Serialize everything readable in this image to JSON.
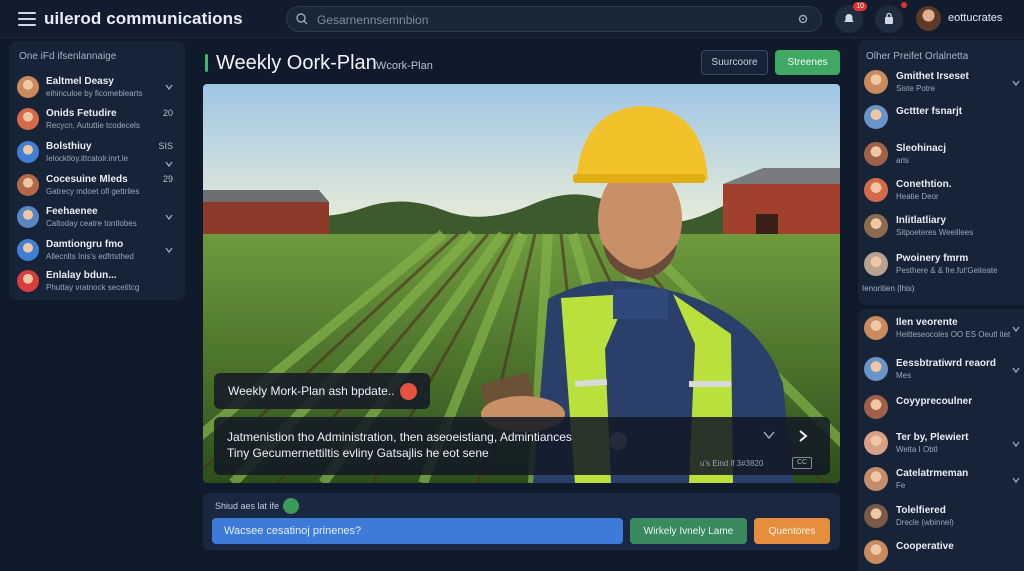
{
  "app": {
    "title": "uilerod communications"
  },
  "search": {
    "placeholder": "Gesarnennsemnbion"
  },
  "topbar": {
    "notification_count": "10",
    "user_name": "eottucrates"
  },
  "left_panel": {
    "title": "One iFd ifsenlannaige",
    "items": [
      {
        "name": "Ealtmel Deasy",
        "sub": "eihinculoe by ficomeblearts",
        "meta": "",
        "avatar_color": "#c98a5e"
      },
      {
        "name": "Onids Fetudire",
        "sub": "Recycn, Aututtie tcodecels",
        "meta": "20",
        "avatar_color": "#d56a4a"
      },
      {
        "name": "Bolsthiuy",
        "sub": "Ielocktloy.ittcatolr.inrt.le",
        "meta": "SIS",
        "avatar_color": "#3f7fd6"
      },
      {
        "name": "Cocesuine Mleds",
        "sub": "Gatrecy mdoet ofl gettriles",
        "meta": "29",
        "avatar_color": "#b2694a"
      },
      {
        "name": "Feehaenee",
        "sub": "Caltoday ceatre tontlobes",
        "meta": "",
        "avatar_color": "#5b86c4"
      },
      {
        "name": "Damtiongru fmo",
        "sub": "Allecnlts Inis's edfrtsthed",
        "meta": "",
        "avatar_color": "#3f7fd6"
      },
      {
        "name": "Enlalay bdun...",
        "sub": "Phuttay vratnock secetitcg",
        "meta": "",
        "avatar_color": "#d93e3e"
      }
    ]
  },
  "main": {
    "title": "Weekly Oork-Plan",
    "subtitle": "Wcork-Plan",
    "btn_source": "Suurcoore",
    "btn_stream": "Streenes",
    "bubble_text": "Weekly Mork-Plan ash bpdate..",
    "caption_line1": "Jatmenistion tho Administration, then aseoeistiang, Admintiances",
    "caption_line2": "Tiny Gecumernettiltis evliny  Gatsajlis he eot sene",
    "caption_timestamp": "u's Eind lf 3#3820",
    "cc_label": "CC"
  },
  "composer": {
    "label": "Shiud aes lat ife",
    "placeholder": "Wacsee cesatinoj prinenes?",
    "btn_weekly": "Wirkely Ivnely Lame",
    "btn_q": "Quentores"
  },
  "right_panel": {
    "title": "Olher Preifet Orlalnetta",
    "section_label": "Ienoritien (lhis)",
    "items_top": [
      {
        "name": "Gmithet Irseset",
        "sub": "Siste Potre",
        "avatar_color": "#c98a5e"
      },
      {
        "name": "Gcttter fsnarjt",
        "sub": "",
        "avatar_color": "#6a95c9"
      },
      {
        "name": "Sleohinacj",
        "sub": "arls",
        "avatar_color": "#a0614a"
      },
      {
        "name": "Conethtion.",
        "sub": "Heatie Deor",
        "avatar_color": "#d56a4a"
      },
      {
        "name": "Inlitlatliary",
        "sub": "Sitpoeteres Weeillees",
        "avatar_color": "#8c6b4f"
      },
      {
        "name": "Pwoinery fmrm",
        "sub": "Pesthere & & fre.fut'Geiteate",
        "avatar_color": "#b7a38f"
      }
    ],
    "items_bottom": [
      {
        "name": "Ilen veorente",
        "sub": "Heitteseocoles\nOO ES Oeutl itet",
        "avatar_color": "#c98a5e"
      },
      {
        "name": "Eessbtratiwrd reaord",
        "sub": "Mes",
        "avatar_color": "#6a95c9"
      },
      {
        "name": "Coyyprecoulner",
        "sub": "",
        "avatar_color": "#a0614a"
      },
      {
        "name": "Ter by, Plewiert",
        "sub": "Welta I Obtl",
        "avatar_color": "#d9a089"
      },
      {
        "name": "Catelatrmeman",
        "sub": "Fe",
        "avatar_color": "#c48c6a"
      },
      {
        "name": "Tolelfiered",
        "sub": "Drecle (wbinnel)",
        "avatar_color": "#7a5a47"
      },
      {
        "name": "Cooperative",
        "sub": "",
        "avatar_color": "#c98a5e"
      }
    ]
  },
  "colors": {
    "accent_green": "#3fa865",
    "accent_blue": "#3e7bd9",
    "accent_orange": "#e58f3c",
    "background": "#0f1a2b"
  }
}
